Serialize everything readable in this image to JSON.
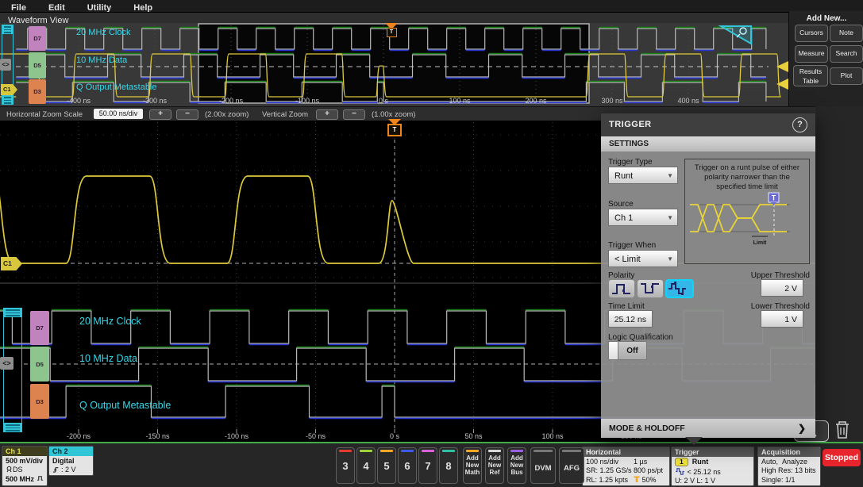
{
  "menu": {
    "items": [
      "File",
      "Edit",
      "Utility",
      "Help"
    ]
  },
  "view": {
    "title": "Waveform View"
  },
  "add_new_panel": {
    "title": "Add New...",
    "buttons": [
      "Cursors",
      "Note",
      "Measure",
      "Search",
      "Results Table",
      "Plot"
    ]
  },
  "channels_digital": [
    {
      "id": "D7",
      "label": "20 MHz Clock",
      "color": "#c183bd"
    },
    {
      "id": "D5",
      "label": "10 MHz Data",
      "color": "#8ec48e"
    },
    {
      "id": "D3",
      "label": "Q Output Metastable",
      "color": "#dd8350"
    }
  ],
  "overview": {
    "time_labels": [
      {
        "t": -400,
        "label": "-400 ns"
      },
      {
        "t": -300,
        "label": "-300 ns"
      },
      {
        "t": -200,
        "label": "-200 ns"
      },
      {
        "t": -100,
        "label": "-100 ns"
      },
      {
        "t": 0,
        "label": "0 s"
      },
      {
        "t": 100,
        "label": "100 ns"
      },
      {
        "t": 200,
        "label": "200 ns"
      },
      {
        "t": 300,
        "label": "300 ns"
      },
      {
        "t": 400,
        "label": "400 ns"
      }
    ],
    "c1_tag": "C1",
    "group_tag": "<>",
    "trigger_label": "T"
  },
  "zoom_bar": {
    "h_label": "Horizontal Zoom Scale",
    "h_value": "50.00 ns/div",
    "plus": "+",
    "minus": "−",
    "h_zoom": "(2.00x zoom)",
    "v_label": "Vertical Zoom",
    "v_zoom": "(1.00x zoom)"
  },
  "main_view": {
    "time_labels": [
      {
        "t": -200,
        "label": "-200 ns"
      },
      {
        "t": -150,
        "label": "-150 ns"
      },
      {
        "t": -100,
        "label": "-100 ns"
      },
      {
        "t": -50,
        "label": "-50 ns"
      },
      {
        "t": 0,
        "label": "0 s"
      },
      {
        "t": 50,
        "label": "50 ns"
      },
      {
        "t": 100,
        "label": "100 ns"
      },
      {
        "t": 150,
        "label": "150 ns"
      }
    ],
    "c1_tag": "C1",
    "group_tag": "<>",
    "trigger_label": "T"
  },
  "signals": {
    "clock": {
      "period": 50,
      "first_rise": -467,
      "high_width": 25
    },
    "data": {
      "period": 100,
      "first_rise": -162,
      "high_width": 44
    },
    "q_highs": [
      [
        -508,
        -454
      ],
      [
        -408,
        -354
      ],
      [
        -308,
        -254
      ],
      [
        -208,
        -154
      ],
      [
        -107,
        -54
      ],
      [
        -8,
        0
      ],
      [
        266,
        316
      ],
      [
        366,
        419
      ],
      [
        466,
        517
      ]
    ],
    "analog_pulses": [
      [
        -508,
        -454,
        1
      ],
      [
        -408,
        -354,
        1
      ],
      [
        -308,
        -254,
        1
      ],
      [
        -208,
        -155,
        1
      ],
      [
        -106,
        -55,
        1
      ],
      [
        -10,
        -1,
        0.72
      ],
      [
        266,
        316,
        1
      ],
      [
        366,
        416,
        1
      ],
      [
        466,
        516,
        1
      ]
    ]
  },
  "trigger_panel": {
    "title": "TRIGGER",
    "help": "?",
    "tab": "SETTINGS",
    "type_label": "Trigger Type",
    "type_value": "Runt",
    "source_label": "Source",
    "source_value": "Ch 1",
    "when_label": "Trigger When",
    "when_value": "< Limit",
    "description": "Trigger on a runt pulse of either polarity narrower than the specified time limit",
    "illustration_limit": "Limit",
    "illustration_t": "T",
    "polarity_label": "Polarity",
    "upper_label": "Upper Threshold",
    "upper_value": "2 V",
    "time_limit_label": "Time Limit",
    "time_limit_value": "25.12 ns",
    "lower_label": "Lower Threshold",
    "lower_value": "1 V",
    "logic_label": "Logic Qualification",
    "logic_value": "Off",
    "mode_label": "MODE & HOLDOFF",
    "chevron": "❯"
  },
  "bottom_bar": {
    "ch1": {
      "name": "Ch 1",
      "v_div": "500 mV/div",
      "probe": "DS",
      "bw": "500 MHz"
    },
    "ch2": {
      "name": "Ch 2",
      "mode": "Digital",
      "threshold": ": 2 V"
    },
    "channel_buttons": [
      {
        "n": "3",
        "color": "#e4392f"
      },
      {
        "n": "4",
        "color": "#9fd13c"
      },
      {
        "n": "5",
        "color": "#f5a623"
      },
      {
        "n": "6",
        "color": "#3c5ae8"
      },
      {
        "n": "7",
        "color": "#d961d9"
      },
      {
        "n": "8",
        "color": "#2fbfa5"
      }
    ],
    "add_buttons": [
      {
        "l1": "Add",
        "l2": "New",
        "l3": "Math",
        "color": "#f5a623"
      },
      {
        "l1": "Add",
        "l2": "New",
        "l3": "Ref",
        "color": "#d8d8d8"
      },
      {
        "l1": "Add",
        "l2": "New",
        "l3": "Bus",
        "color": "#9a5fe0"
      }
    ],
    "dvm": "DVM",
    "afg": "AFG",
    "horizontal": {
      "title": "Horizontal",
      "r1c1": "100 ns/div",
      "r1c2": "1 µs",
      "r2c1": "SR: 1.25 GS/s",
      "r2c2": "800 ps/pt",
      "r3c1": "RL: 1.25 kpts",
      "r3c2": "50%"
    },
    "trigger": {
      "title": "Trigger",
      "badge": "1",
      "type": "Runt",
      "limit": "< 25.12 ns",
      "levels": "U: 2 V  L: 1 V"
    },
    "acquisition": {
      "title": "Acquisition",
      "r1a": "Auto,",
      "r1b": "Analyze",
      "r2": "High Res: 13 bits",
      "r3": "Single: 1/1"
    },
    "stopped": "Stopped"
  },
  "colors": {
    "accent_cyan": "#35c4d7",
    "trace_yellow": "#ddc93a",
    "digital_gray": "#b9b9b9",
    "digital_high_green": "#1a7d1a",
    "digital_low_blue": "#2836d6",
    "trigger_orange": "#f0841c",
    "stopped_red": "#e8252c",
    "selected_polarity": "#35b6e9"
  }
}
